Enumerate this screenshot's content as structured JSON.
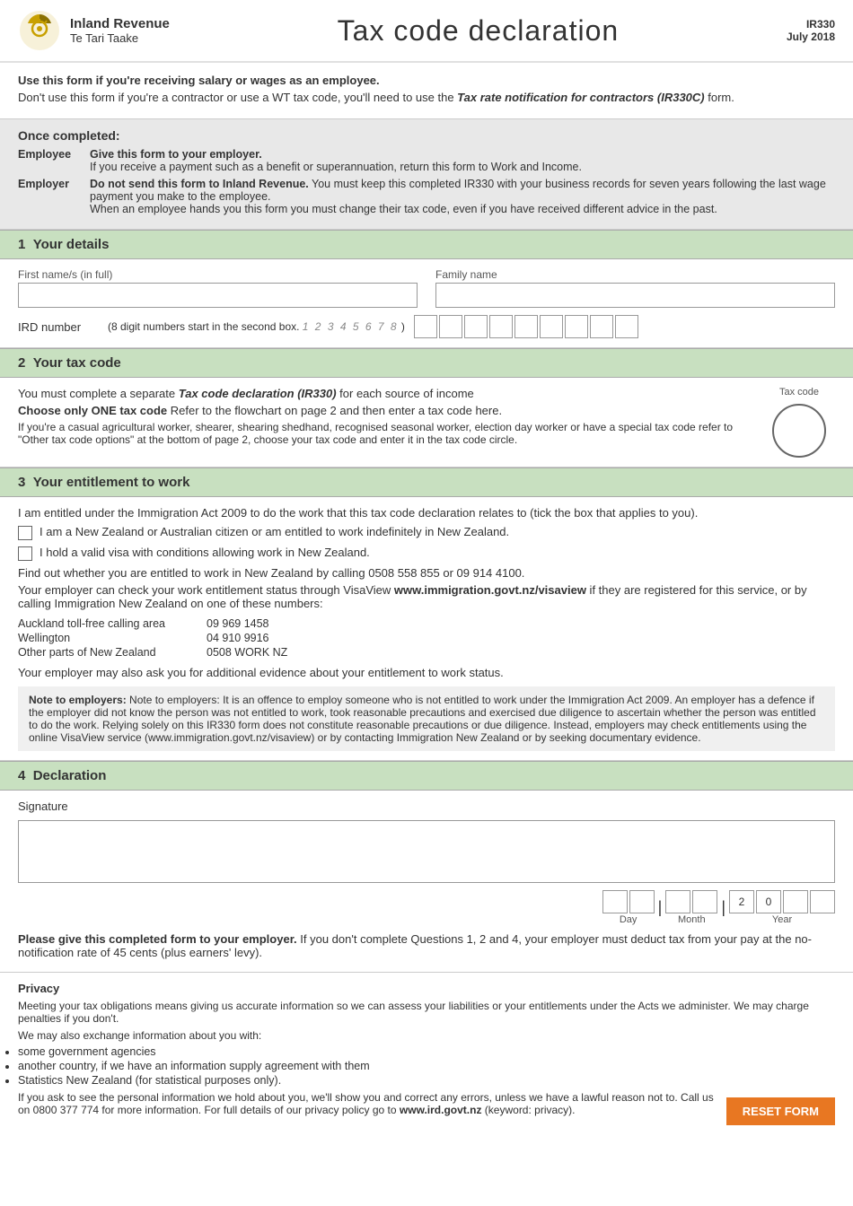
{
  "header": {
    "org_name": "Inland Revenue",
    "org_sub": "Te Tari Taake",
    "title": "Tax code declaration",
    "form_ref": "IR330",
    "form_date": "July 2018"
  },
  "intro": {
    "line1": "Use this form if you're receiving salary or wages as an employee.",
    "line2_prefix": "Don't use this form if you're a contractor or use a WT tax code, you'll need to use the ",
    "line2_italic": "Tax rate notification for contractors (IR330C)",
    "line2_suffix": " form."
  },
  "once_completed": {
    "title": "Once completed:",
    "employee_label": "Employee",
    "employee_text": "Give this form to your employer.",
    "employee_sub": "If you receive a payment such as a benefit or superannuation, return this form to Work and Income.",
    "employer_label": "Employer",
    "employer_text": "Do not send this form to Inland Revenue.",
    "employer_sub1": "You must keep this completed IR330 with your business records for seven years following the last wage payment you make to the employee.",
    "employer_sub2": "When an employee hands you this form you must change their tax code, even if you have received different advice in the past."
  },
  "section1": {
    "number": "1",
    "title": "Your details",
    "first_name_label": "First name/s (in full)",
    "family_name_label": "Family name",
    "ird_label": "IRD number",
    "ird_hint": "(8 digit numbers start in the second box.",
    "ird_digit_hint": "1 2 3 4 5 6 7 8",
    "ird_suffix": ")"
  },
  "section2": {
    "number": "2",
    "title": "Your tax code",
    "para1_prefix": "You must complete a separate ",
    "para1_italic": "Tax code declaration (IR330)",
    "para1_suffix": " for each source of income",
    "para2_bold": "Choose only ONE tax code",
    "para2_suffix": "   Refer to the flowchart on page 2 and then enter a tax code here.",
    "para3": "If you're a casual agricultural worker, shearer, shearing shedhand, recognised seasonal worker, election day worker or have a special tax code refer to \"Other tax code options\" at the bottom of page 2, choose your tax code and enter it in the tax code circle.",
    "tax_code_label": "Tax code"
  },
  "section3": {
    "number": "3",
    "title": "Your entitlement to work",
    "intro": "I am entitled under the Immigration Act 2009 to do the work that this tax code declaration relates to (tick the box that applies to you).",
    "checkbox1": "I am a New Zealand or Australian citizen or am entitled to work indefinitely in New Zealand.",
    "checkbox2": "I hold a valid visa with conditions allowing work in New Zealand.",
    "find_out": "Find out whether you are entitled to work in New Zealand by calling 0508 558 855 or 09 914 4100.",
    "employer_check": "Your employer can check your work entitlement status through VisaView ",
    "employer_check_link": "www.immigration.govt.nz/visaview",
    "employer_check_suffix": " if they are registered for this service, or by calling Immigration New Zealand on one of these numbers:",
    "contacts": [
      {
        "area": "Auckland toll-free calling area",
        "number": "09 969 1458"
      },
      {
        "area": "Wellington",
        "number": "04 910 9916"
      },
      {
        "area": "Other parts of New Zealand",
        "number": "0508 WORK NZ"
      }
    ],
    "employer_ask": "Your employer may also ask you for additional evidence about your entitlement to work status.",
    "note": "Note to employers: It is an offence to employ someone who is not entitled to work under the Immigration Act 2009. An employer has a defence if the employer did not know the person was not entitled to work, took reasonable precautions and exercised due diligence to ascertain whether the person was entitled to do the work. Relying solely on this IR330 form does not constitute reasonable precautions or due diligence. Instead, employers may check entitlements using the online VisaView service (www.immigration.govt.nz/visaview) or by contacting Immigration New Zealand or by seeking documentary evidence."
  },
  "section4": {
    "number": "4",
    "title": "Declaration",
    "sig_label": "Signature",
    "day_label": "Day",
    "month_label": "Month",
    "year_label": "Year",
    "year_val1": "2",
    "year_val2": "0",
    "please_give": "Please give this completed form to your employer.",
    "please_give_suffix": " If you don't complete Questions 1, 2 and 4, your employer must deduct tax from your pay at the no-notification rate of 45 cents (plus earners' levy)."
  },
  "privacy": {
    "title": "Privacy",
    "text1": "Meeting your tax obligations means giving us accurate information so we can assess your liabilities or your entitlements under the Acts we administer. We may charge penalties if you don't.",
    "text2": "We may also exchange information about you with:",
    "bullets": [
      "some government agencies",
      "another country, if we have an information supply agreement with them",
      "Statistics New Zealand (for statistical purposes only)."
    ],
    "text3_prefix": "If you ask to see the personal information we hold about you, we'll show you and correct any errors, unless we have a lawful reason not to. Call us on 0800 377 774 for more information. For full details of our privacy policy go to ",
    "text3_link": "www.ird.govt.nz",
    "text3_suffix": " (keyword: privacy).",
    "reset_btn": "RESET FORM"
  }
}
